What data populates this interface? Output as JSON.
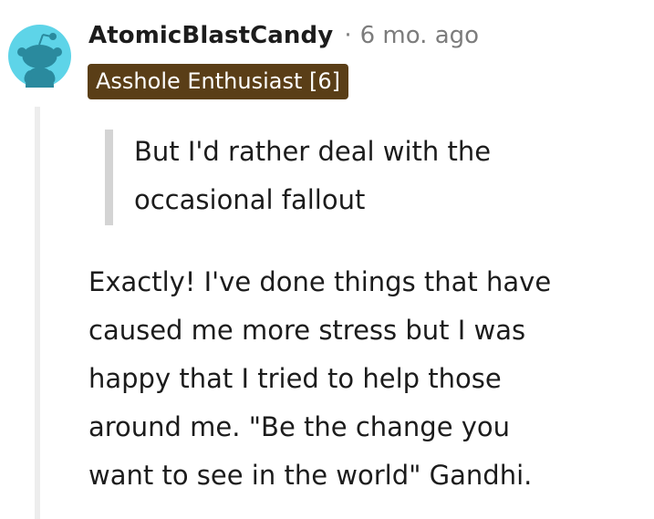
{
  "comment": {
    "avatar_icon": "snoo-avatar-icon",
    "avatar_bg": "#5ed4e8",
    "avatar_fg": "#2a8a9e",
    "author": "AtomicBlastCandy",
    "separator": "·",
    "time": "6 mo. ago",
    "flair": "Asshole Enthusiast [6]",
    "flair_bg": "#5a3e17",
    "quote_lines": [
      "But I'd rather deal with the",
      "occasional fallout"
    ],
    "body_lines": [
      "Exactly! I've done things that have",
      "caused me more stress but I was",
      "happy that I tried to help those",
      "around me. \"Be the change you",
      "want to see in the world\" Gandhi."
    ]
  }
}
